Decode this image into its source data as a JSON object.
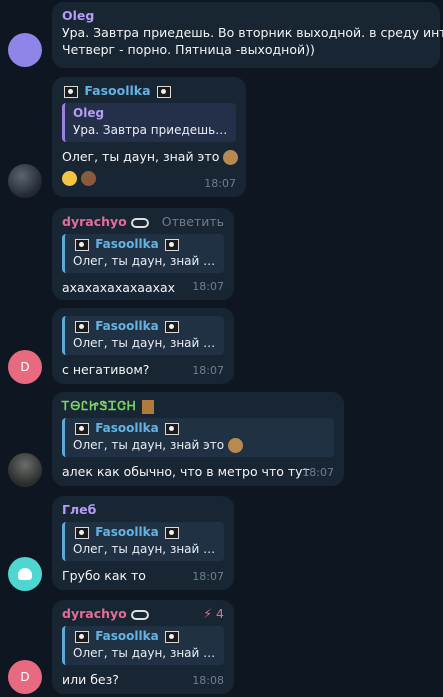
{
  "messages": [
    {
      "sender": "Oleg",
      "text_line1": "Ура. Завтра приедешь. Во вторник выходной. в среду инта.",
      "text_line2": "Четверг - порно. Пятница -выходной))"
    },
    {
      "sender": "Fasoollka",
      "reply_name": "Oleg",
      "reply_text": "Ура. Завтра приедешь. ...",
      "text": "Олег, ты даун, знай это",
      "time": "18:07"
    },
    {
      "sender": "dyrachyo",
      "action": "Ответить",
      "reply_name": "Fasoollka",
      "reply_text": "Олег, ты даун, знай эт...",
      "text": "ахахахахахааxах",
      "time": "18:07"
    },
    {
      "reply_name": "Fasoollka",
      "reply_text": "Олег, ты даун, знай эт...",
      "text": "с негативом?",
      "time": "18:07",
      "avatar_letter": "D"
    },
    {
      "sender": "ᎢᎾᏝᏥᏕᏆᏣᎻ",
      "reply_name": "Fasoollka",
      "reply_text": "Олег, ты даун, знай это",
      "text": "алек как обычно, что в метро что тут",
      "time": "18:07"
    },
    {
      "sender": "Глеб",
      "reply_name": "Fasoollka",
      "reply_text": "Олег, ты даун, знай эт...",
      "text": "Грубо как то",
      "time": "18:07"
    },
    {
      "sender": "dyrachyo",
      "badge": "4",
      "reply_name": "Fasoollka",
      "reply_text": "Олег, ты даун, знай эт...",
      "text": "или без?",
      "time": "18:08",
      "avatar_letter": "D"
    }
  ],
  "colors": {
    "background": "#0e1621",
    "bubble": "#182533",
    "accent": "#64b3e2",
    "pink_name": "#e56b98",
    "purple_name": "#b59cf5",
    "green_name": "#7bd36a"
  }
}
